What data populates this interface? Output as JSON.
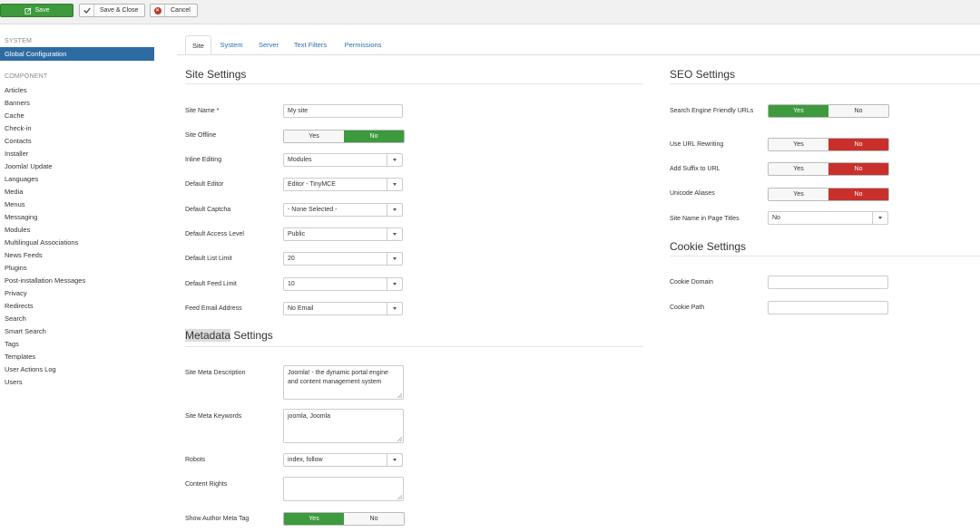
{
  "toolbar": {
    "save_label": "Save",
    "save_close_label": "Save & Close",
    "cancel_label": "Cancel"
  },
  "sidebar": {
    "system_heading": "SYSTEM",
    "active_item": "Global Configuration",
    "component_heading": "COMPONENT",
    "items": [
      "Articles",
      "Banners",
      "Cache",
      "Check-in",
      "Contacts",
      "Installer",
      "Joomla! Update",
      "Languages",
      "Media",
      "Menus",
      "Messaging",
      "Modules",
      "Multilingual Associations",
      "News Feeds",
      "Plugins",
      "Post-installation Messages",
      "Privacy",
      "Redirects",
      "Search",
      "Smart Search",
      "Tags",
      "Templates",
      "User Actions Log",
      "Users"
    ]
  },
  "tabs": [
    "Site",
    "System",
    "Server",
    "Text Filters",
    "Permissions"
  ],
  "site_settings": {
    "title": "Site Settings",
    "site_name_label": "Site Name *",
    "site_name_value": "My site",
    "site_offline_label": "Site Offline",
    "site_offline_yes": "Yes",
    "site_offline_no": "No",
    "inline_editing_label": "Inline Editing",
    "inline_editing_value": "Modules",
    "default_editor_label": "Default Editor",
    "default_editor_value": "Editor - TinyMCE",
    "default_captcha_label": "Default Captcha",
    "default_captcha_value": "- None Selected -",
    "default_access_label": "Default Access Level",
    "default_access_value": "Public",
    "default_list_label": "Default List Limit",
    "default_list_value": "20",
    "default_feed_label": "Default Feed Limit",
    "default_feed_value": "10",
    "feed_email_label": "Feed Email Address",
    "feed_email_value": "No Email"
  },
  "metadata_settings": {
    "title_highlight": "Metadata",
    "title_rest": " Settings",
    "meta_desc_label": "Site Meta Description",
    "meta_desc_value": "Joomla! - the dynamic portal engine and content management system",
    "meta_keywords_label": "Site Meta Keywords",
    "meta_keywords_value": "joomla, Joomla",
    "robots_label": "Robots",
    "robots_value": "index, follow",
    "content_rights_label": "Content Rights",
    "content_rights_value": "",
    "show_author_label": "Show Author Meta Tag",
    "show_author_yes": "Yes",
    "show_author_no": "No"
  },
  "seo_settings": {
    "title": "SEO Settings",
    "sef_label": "Search Engine Friendly URLs",
    "sef_yes": "Yes",
    "sef_no": "No",
    "rewrite_label": "Use URL Rewriting",
    "rewrite_yes": "Yes",
    "rewrite_no": "No",
    "suffix_label": "Add Suffix to URL",
    "suffix_yes": "Yes",
    "suffix_no": "No",
    "unicode_label": "Unicode Aliases",
    "unicode_yes": "Yes",
    "unicode_no": "No",
    "page_titles_label": "Site Name in Page Titles",
    "page_titles_value": "No"
  },
  "cookie_settings": {
    "title": "Cookie Settings",
    "domain_label": "Cookie Domain",
    "domain_value": "",
    "path_label": "Cookie Path",
    "path_value": ""
  },
  "colors": {
    "green": "#3d9a3d",
    "red": "#c9302c",
    "link_blue": "#2a6fb0",
    "active_blue": "#2d6ca2"
  }
}
